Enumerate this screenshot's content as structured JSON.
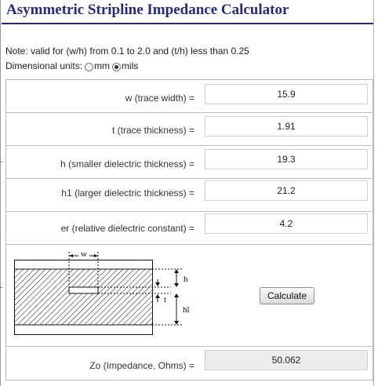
{
  "title": "Asymmetric Stripline Impedance Calculator",
  "note": "Note: valid for (w/h) from 0.1 to 2.0 and (t/h) less than 0.25",
  "units": {
    "label": "Dimensional units:",
    "options": [
      "mm",
      "mils"
    ],
    "selected": "mils"
  },
  "fields": [
    {
      "label": "w (trace width) =",
      "value": "15.9"
    },
    {
      "label": "t (trace thickness) =",
      "value": "1.91"
    },
    {
      "label": "h (smaller dielectric thickness) =",
      "value": "19.3"
    },
    {
      "label": "h1 (larger dielectric thickness) =",
      "value": "21.2"
    },
    {
      "label": "er (relative dielectric constant) =",
      "value": "4.2"
    }
  ],
  "diagram": {
    "w": "w",
    "h": "h",
    "t": "t",
    "h1": "hl"
  },
  "calculate_label": "Calculate",
  "result": {
    "label": "Zo (Impedance, Ohms) =",
    "value": "50.062"
  }
}
